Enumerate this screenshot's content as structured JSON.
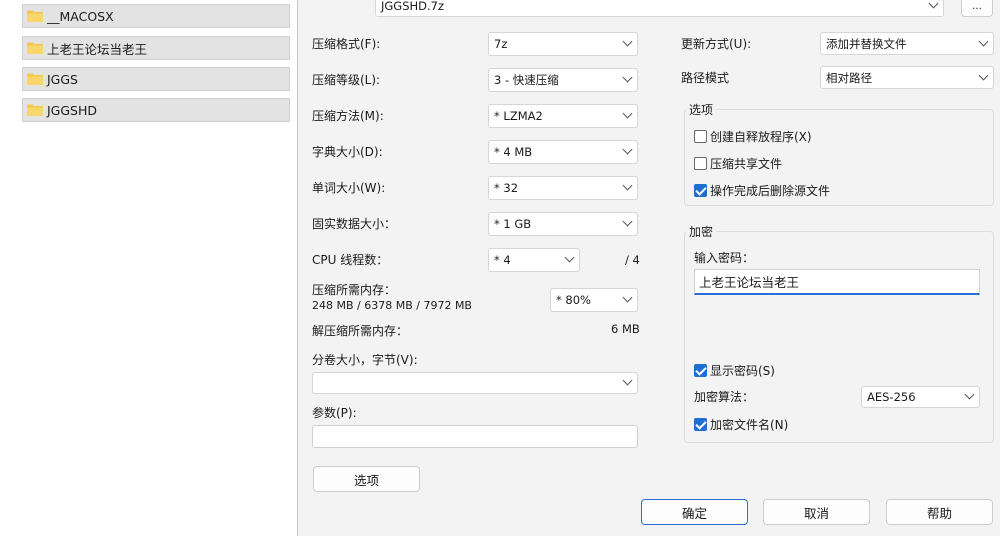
{
  "file_list": [
    {
      "name": "__MACOSX"
    },
    {
      "name": "上老王论坛当老王"
    },
    {
      "name": "JGGS"
    },
    {
      "name": "JGGSHD"
    }
  ],
  "archive": {
    "filename": "JGGSHD.7z",
    "browse_label": "..."
  },
  "left": {
    "format_label": "压缩格式(F):",
    "format_value": "7z",
    "level_label": "压缩等级(L):",
    "level_value": "3 - 快速压缩",
    "method_label": "压缩方法(M):",
    "method_value": "* LZMA2",
    "dict_label": "字典大小(D):",
    "dict_value": "* 4 MB",
    "word_label": "单词大小(W):",
    "word_value": "* 32",
    "solid_label": "固实数据大小：",
    "solid_value": "* 1 GB",
    "threads_label": "CPU 线程数：",
    "threads_value": "* 4",
    "threads_total": "/ 4",
    "mem_label": "压缩所需内存：",
    "mem_detail": "248 MB / 6378 MB / 7972 MB",
    "mem_value": "* 80%",
    "decomp_label": "解压缩所需内存：",
    "decomp_value": "6 MB",
    "split_label": "分卷大小，字节(V):",
    "split_value": "",
    "params_label": "参数(P):",
    "params_value": "",
    "options_button": "选项"
  },
  "right": {
    "update_label": "更新方式(U):",
    "update_value": "添加并替换文件",
    "path_label": "路径模式",
    "path_value": "相对路径",
    "options_title": "选项",
    "opt_sfx": {
      "label": "创建自释放程序(X)",
      "checked": false
    },
    "opt_shared": {
      "label": "压缩共享文件",
      "checked": false
    },
    "opt_delete": {
      "label": "操作完成后删除源文件",
      "checked": true
    },
    "encrypt_title": "加密",
    "password_label": "输入密码：",
    "password_value": "上老王论坛当老王",
    "show_password": {
      "label": "显示密码(S)",
      "checked": true
    },
    "enc_method_label": "加密算法：",
    "enc_method_value": "AES-256",
    "encrypt_names": {
      "label": "加密文件名(N)",
      "checked": true
    }
  },
  "buttons": {
    "ok": "确定",
    "cancel": "取消",
    "help": "帮助"
  },
  "colors": {
    "accent": "#1f6fd1",
    "folder": "#f4c84b"
  }
}
